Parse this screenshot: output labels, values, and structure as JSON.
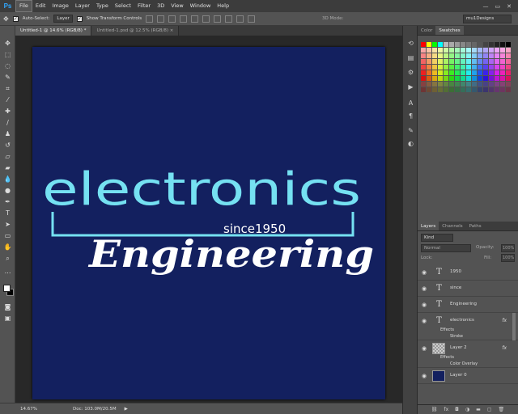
{
  "app": {
    "logo": "Ps"
  },
  "menu": [
    "File",
    "Edit",
    "Image",
    "Layer",
    "Type",
    "Select",
    "Filter",
    "3D",
    "View",
    "Window",
    "Help"
  ],
  "window_controls": [
    "—",
    "▭",
    "✕"
  ],
  "options": {
    "auto_select_label": "Auto-Select:",
    "auto_select_value": "Layer",
    "transform_label": "Show Transform Controls",
    "mode_3d": "3D Mode:",
    "workspace": "mu1Designs"
  },
  "tabs": [
    {
      "label": "Untitled-1 @ 14.6% (RGB/8) *"
    },
    {
      "label": "Untitled-1.psd @ 12.5% (RGB/8) ×"
    }
  ],
  "canvas": {
    "background": "#13205f",
    "line1": "electronics",
    "since": "since1950",
    "line2": "Engineering",
    "text_color": "#75e1f2"
  },
  "status": {
    "zoom": "14.67%",
    "doc": "Doc: 103.0M/20.5M",
    "arrow": "▶"
  },
  "swatches_panel": {
    "tabs": [
      "Color",
      "Swatches"
    ]
  },
  "layers_panel": {
    "tabs": [
      "Layers",
      "Channels",
      "Paths"
    ],
    "filter": "Kind",
    "blend_mode": "Normal",
    "opacity_label": "Opacity:",
    "opacity_value": "100%",
    "lock_label": "Lock:",
    "fill_label": "Fill:",
    "fill_value": "100%",
    "layers": [
      {
        "name": "1950",
        "kind": "type"
      },
      {
        "name": "since",
        "kind": "type"
      },
      {
        "name": "Engineering",
        "kind": "type"
      },
      {
        "name": "electronics",
        "kind": "type",
        "fx": "fx",
        "effects_label": "Effects",
        "effect": "Stroke"
      },
      {
        "name": "Layer 2",
        "kind": "image",
        "fx": "fx",
        "effects_label": "Effects",
        "effect": "Color Overlay"
      },
      {
        "name": "Layer 0",
        "kind": "fill",
        "color": "#13205f"
      }
    ]
  }
}
